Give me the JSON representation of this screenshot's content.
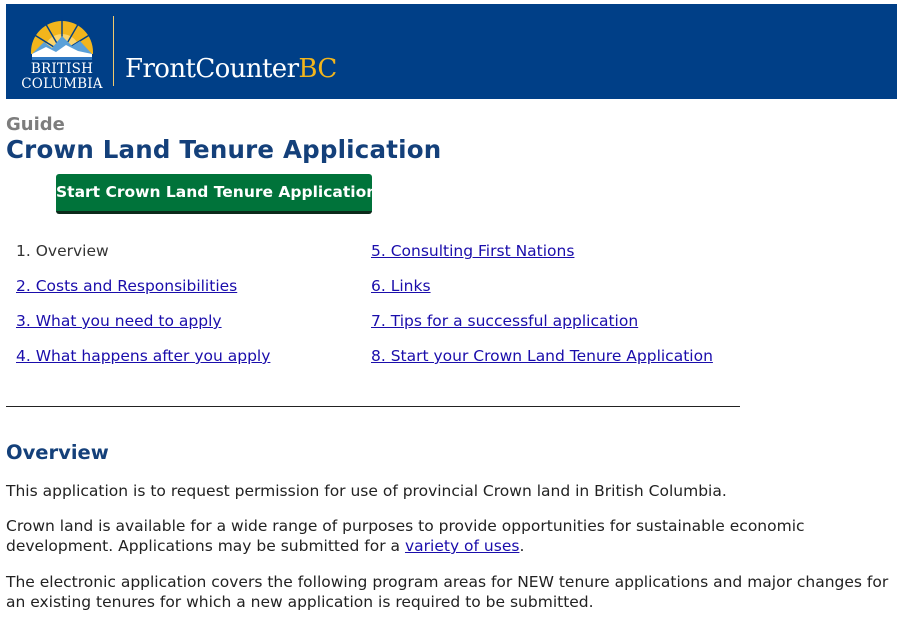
{
  "banner": {
    "logo_line1": "BRITISH",
    "logo_line2": "COLUMBIA",
    "brand_main": "FrontCounter",
    "brand_suffix": "BC",
    "colors": {
      "background": "#003f87",
      "gold": "#f2b51c"
    }
  },
  "header": {
    "eyebrow": "Guide",
    "title": "Crown Land Tenure Application"
  },
  "start_button": {
    "label": "Start Crown Land Tenure Application",
    "color": "#00733a"
  },
  "toc": {
    "column1": [
      {
        "label": "1. Overview",
        "current": true
      },
      {
        "label": "2. Costs and Responsibilities"
      },
      {
        "label": "3. What you need to apply"
      },
      {
        "label": "4. What happens after you apply"
      }
    ],
    "column2": [
      {
        "label": "5. Consulting First Nations"
      },
      {
        "label": "6. Links"
      },
      {
        "label": "7. Tips for a successful application"
      },
      {
        "label": "8. Start your Crown Land Tenure Application"
      }
    ]
  },
  "overview": {
    "title": "Overview",
    "para1": "This application is to request permission for use of provincial Crown land in British Columbia.",
    "para2_before": "Crown land is available for a wide range of purposes to provide opportunities for sustainable economic development. Applications may be submitted for a ",
    "para2_link": "variety of uses",
    "para2_after": ".",
    "para3": "The electronic application covers the following program areas for NEW tenure applications and major changes for an existing tenures for which a new application is required to be submitted."
  }
}
